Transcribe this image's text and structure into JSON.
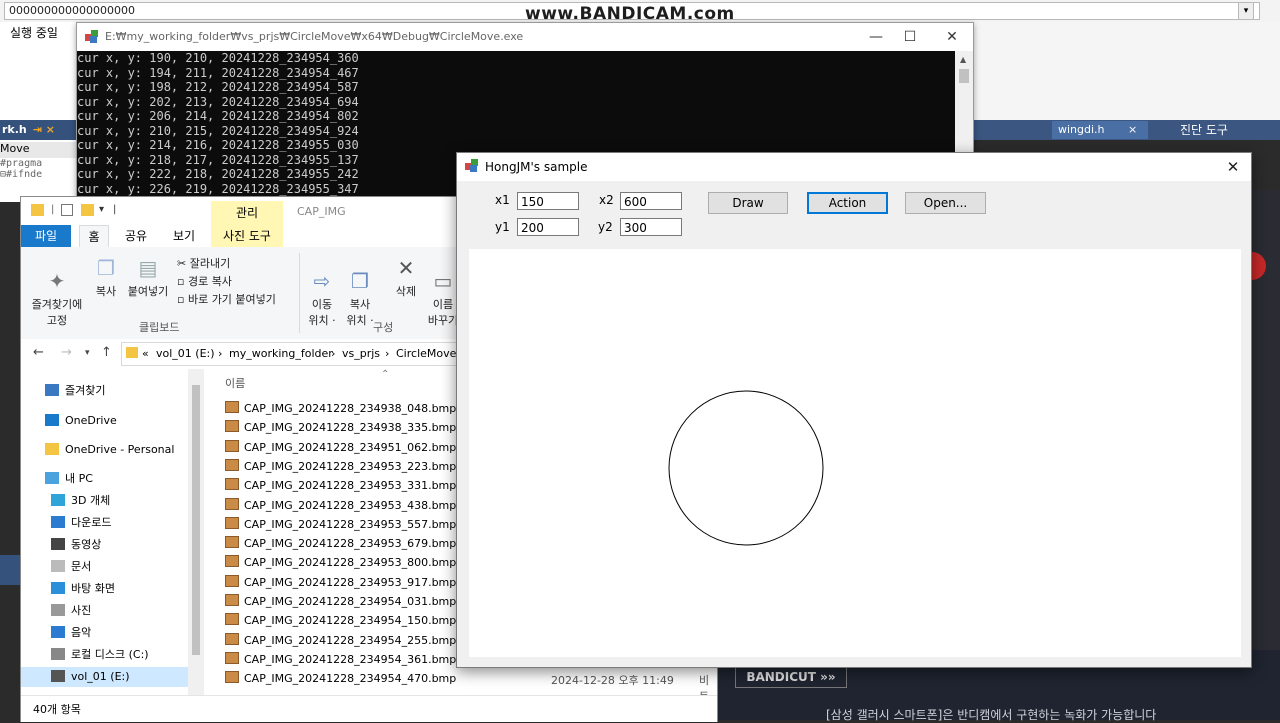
{
  "watermark": "www.BANDICAM.com",
  "ide": {
    "address_text": "000000000000000000",
    "running_label": "실행 중일",
    "file_tab": "rk.h",
    "file_tab_pin": "⇥ ×",
    "project_label": "Move",
    "code_lines": [
      "#pragma",
      "⊟#ifnde"
    ],
    "right_tab": "wingdi.h",
    "right_tab_close": "×",
    "diag_label": "진단 도구",
    "bandicut": "BANDICUT »»",
    "notice": "[삼성 갤러시 스마트폰]은 반디캠에서 구현하는 녹화가 가능합니다"
  },
  "console": {
    "title": "E:₩my_working_folder₩vs_prjs₩CircleMove₩x64₩Debug₩CircleMove.exe",
    "minimize": "—",
    "maximize": "☐",
    "close": "✕",
    "lines": [
      "cur x, y: 190, 210, 20241228_234954_360",
      "cur x, y: 194, 211, 20241228_234954_467",
      "cur x, y: 198, 212, 20241228_234954_587",
      "cur x, y: 202, 213, 20241228_234954_694",
      "cur x, y: 206, 214, 20241228_234954_802",
      "cur x, y: 210, 215, 20241228_234954_924",
      "cur x, y: 214, 216, 20241228_234955_030",
      "cur x, y: 218, 217, 20241228_234955_137",
      "cur x, y: 222, 218, 20241228_234955_242",
      "cur x, y: 226, 219, 20241228_234955_347"
    ]
  },
  "explorer": {
    "context_tab": "관리",
    "context_name": "CAP_IMG",
    "tabs": {
      "file": "파일",
      "home": "홈",
      "share": "공유",
      "view": "보기",
      "tool": "사진 도구"
    },
    "ribbon": {
      "pin": "즐겨찾기에\n고정",
      "copy": "복사",
      "paste": "붙여넣기",
      "cut": "잘라내기",
      "copy_path": "경로 복사",
      "paste_shortcut": "바로 가기 붙여넣기",
      "move_to": "이동\n위치 ·",
      "copy_to": "복사\n위치 ·",
      "delete": "삭제",
      "rename": "이름\n바꾸기",
      "group_clipboard": "클립보드",
      "group_organize": "구성"
    },
    "path": [
      "«",
      "vol_01 (E:)",
      "›",
      "my_working_folder",
      "›",
      "vs_prjs",
      "›",
      "CircleMove"
    ],
    "nav": [
      {
        "label": "즐겨찾기",
        "icon": "star-icon",
        "color": "#3a78c2"
      },
      {
        "label": "OneDrive",
        "icon": "cloud-icon",
        "color": "#1979ca"
      },
      {
        "label": "OneDrive - Personal",
        "icon": "folder-icon",
        "color": "#f4c542"
      },
      {
        "label": "내 PC",
        "icon": "pc-icon",
        "color": "#4aa3df"
      },
      {
        "label": "3D 개체",
        "icon": "cube-icon",
        "color": "#2fa4d9"
      },
      {
        "label": "다운로드",
        "icon": "download-icon",
        "color": "#2b7bd0"
      },
      {
        "label": "동영상",
        "icon": "video-icon",
        "color": "#444"
      },
      {
        "label": "문서",
        "icon": "document-icon",
        "color": "#bbb"
      },
      {
        "label": "바탕 화면",
        "icon": "desktop-icon",
        "color": "#2b8fd9"
      },
      {
        "label": "사진",
        "icon": "pictures-icon",
        "color": "#999"
      },
      {
        "label": "음악",
        "icon": "music-icon",
        "color": "#2b7bd0"
      },
      {
        "label": "로컬 디스크 (C:)",
        "icon": "disk-icon",
        "color": "#888"
      },
      {
        "label": "vol_01 (E:)",
        "icon": "drive-icon",
        "color": "#555"
      }
    ],
    "column_name": "이름",
    "files": [
      "CAP_IMG_20241228_234938_048.bmp",
      "CAP_IMG_20241228_234938_335.bmp",
      "CAP_IMG_20241228_234951_062.bmp",
      "CAP_IMG_20241228_234953_223.bmp",
      "CAP_IMG_20241228_234953_331.bmp",
      "CAP_IMG_20241228_234953_438.bmp",
      "CAP_IMG_20241228_234953_557.bmp",
      "CAP_IMG_20241228_234953_679.bmp",
      "CAP_IMG_20241228_234953_800.bmp",
      "CAP_IMG_20241228_234953_917.bmp",
      "CAP_IMG_20241228_234954_031.bmp",
      "CAP_IMG_20241228_234954_150.bmp",
      "CAP_IMG_20241228_234954_255.bmp",
      "CAP_IMG_20241228_234954_361.bmp",
      "CAP_IMG_20241228_234954_470.bmp"
    ],
    "last_row_date": "2024-12-28 오후 11:49",
    "last_row_type": "비트",
    "status": "40개 항목"
  },
  "sample": {
    "title": "HongJM's sample",
    "close": "✕",
    "x1_label": "x1",
    "x1_value": "150",
    "y1_label": "y1",
    "y1_value": "200",
    "x2_label": "x2",
    "x2_value": "600",
    "y2_label": "y2",
    "y2_value": "300",
    "draw_label": "Draw",
    "action_label": "Action",
    "open_label": "Open..."
  }
}
